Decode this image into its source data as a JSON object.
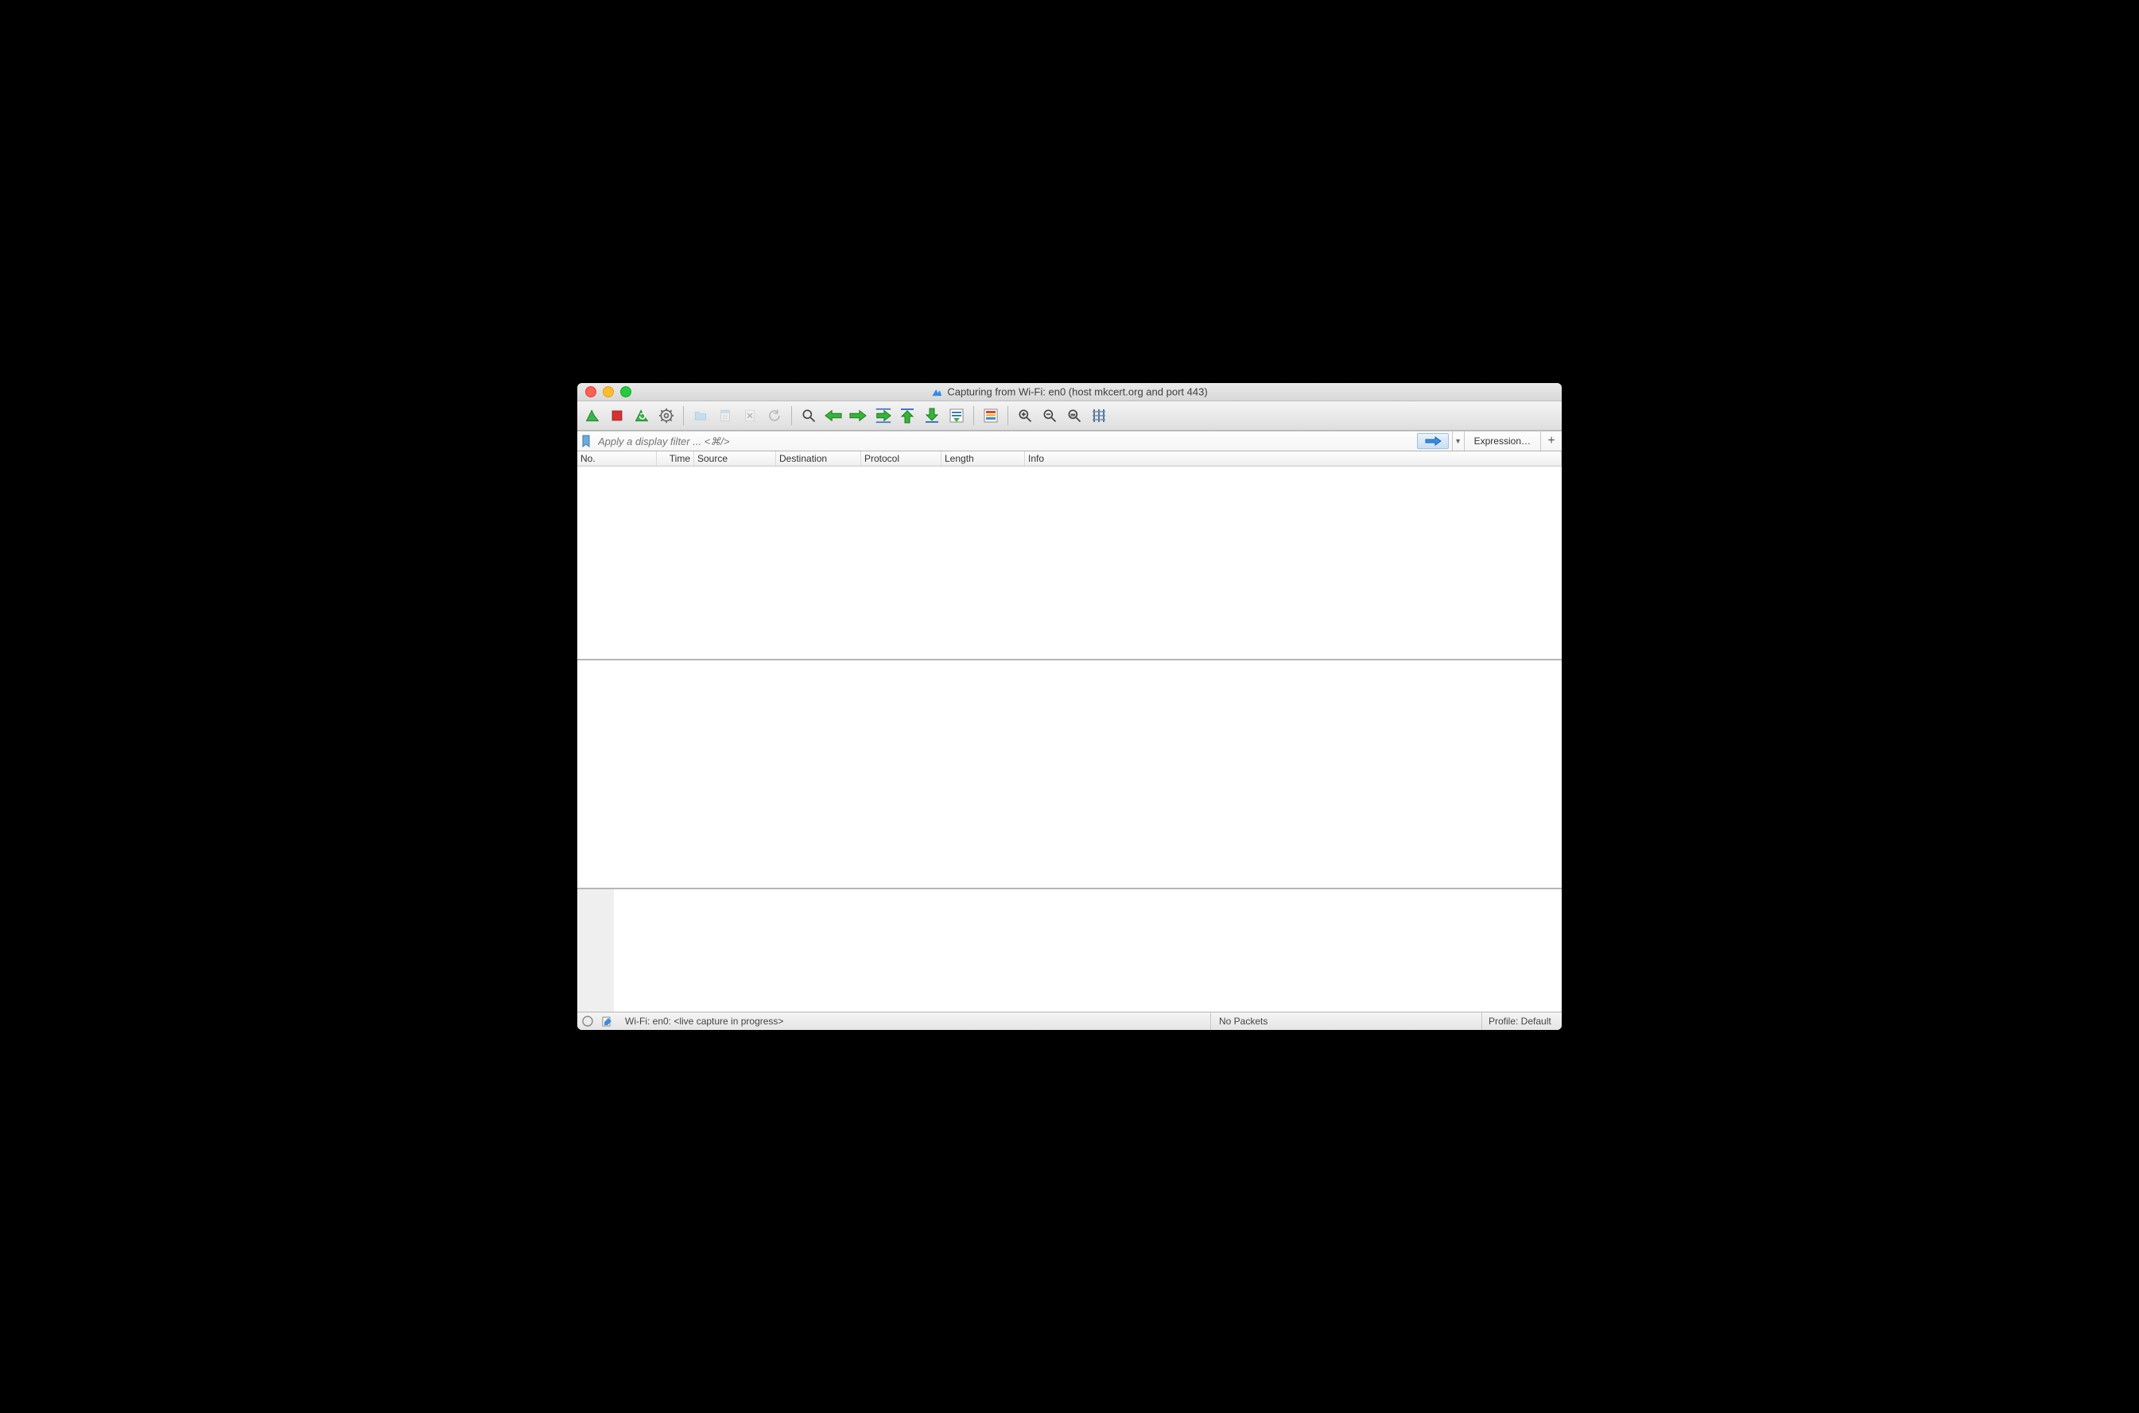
{
  "window": {
    "title": "Capturing from Wi-Fi: en0 (host mkcert.org and port 443)"
  },
  "toolbar": {
    "start_label": "Start capture",
    "stop_label": "Stop capture",
    "restart_label": "Restart capture",
    "options_label": "Capture options",
    "open_label": "Open",
    "save_label": "Save",
    "close_label": "Close",
    "reload_label": "Reload",
    "find_label": "Find packet",
    "prev_label": "Go back",
    "next_label": "Go forward",
    "jump_label": "Jump to packet",
    "first_label": "Go to first packet",
    "last_label": "Go to last packet",
    "autoscroll_label": "Auto scroll",
    "colorize_label": "Colorize",
    "zoom_in_label": "Zoom in",
    "zoom_out_label": "Zoom out",
    "zoom_reset_label": "Zoom 1:1",
    "resize_cols_label": "Resize columns"
  },
  "filter": {
    "placeholder": "Apply a display filter ... <⌘/>",
    "value": "",
    "expression_label": "Expression…",
    "add_label": "+"
  },
  "columns": {
    "no": "No.",
    "time": "Time",
    "src": "Source",
    "dst": "Destination",
    "proto": "Protocol",
    "length": "Length",
    "info": "Info"
  },
  "status": {
    "message": "Wi-Fi: en0: <live capture in progress>",
    "packets": "No Packets",
    "profile": "Profile: Default"
  }
}
